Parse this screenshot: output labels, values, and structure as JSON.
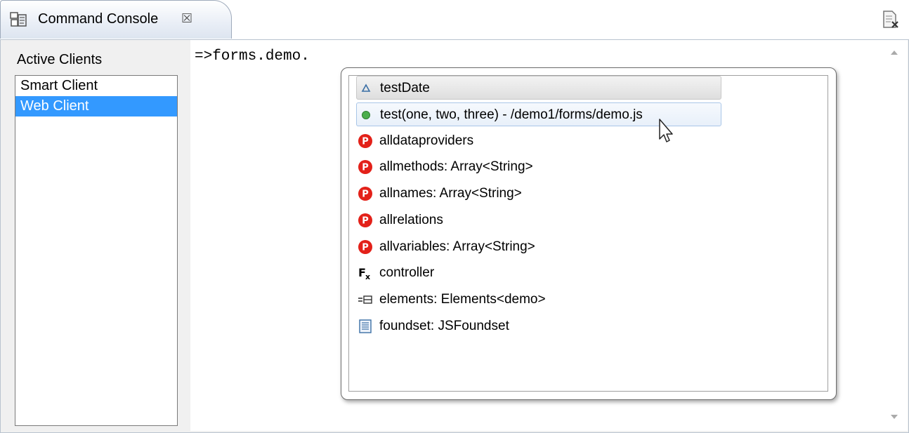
{
  "tab": {
    "title": "Command Console",
    "close_glyph": "☒",
    "icon": "console-icon"
  },
  "toolbar": {
    "view_menu_icon": "view-menu-icon"
  },
  "clients": {
    "label": "Active Clients",
    "items": [
      {
        "label": "Smart Client",
        "selected": false
      },
      {
        "label": "Web Client",
        "selected": true
      }
    ]
  },
  "console": {
    "text": "=>forms.demo."
  },
  "completions": {
    "items": [
      {
        "label": "testDate",
        "icon": "triangle-icon"
      },
      {
        "label": "test(one, two, three) - /demo1/forms/demo.js",
        "icon": "green-dot-icon"
      },
      {
        "label": "alldataproviders",
        "icon": "property-p-icon"
      },
      {
        "label": "allmethods: Array<String>",
        "icon": "property-p-icon"
      },
      {
        "label": "allnames: Array<String>",
        "icon": "property-p-icon"
      },
      {
        "label": "allrelations",
        "icon": "property-p-icon"
      },
      {
        "label": "allvariables: Array<String>",
        "icon": "property-p-icon"
      },
      {
        "label": "controller",
        "icon": "function-fx-icon"
      },
      {
        "label": "elements: Elements<demo>",
        "icon": "elements-icon"
      },
      {
        "label": "foundset: JSFoundset",
        "icon": "foundset-icon"
      }
    ]
  },
  "colors": {
    "selection": "#3399ff",
    "property_icon": "#e32119",
    "green_dot": "#4cae4c"
  }
}
